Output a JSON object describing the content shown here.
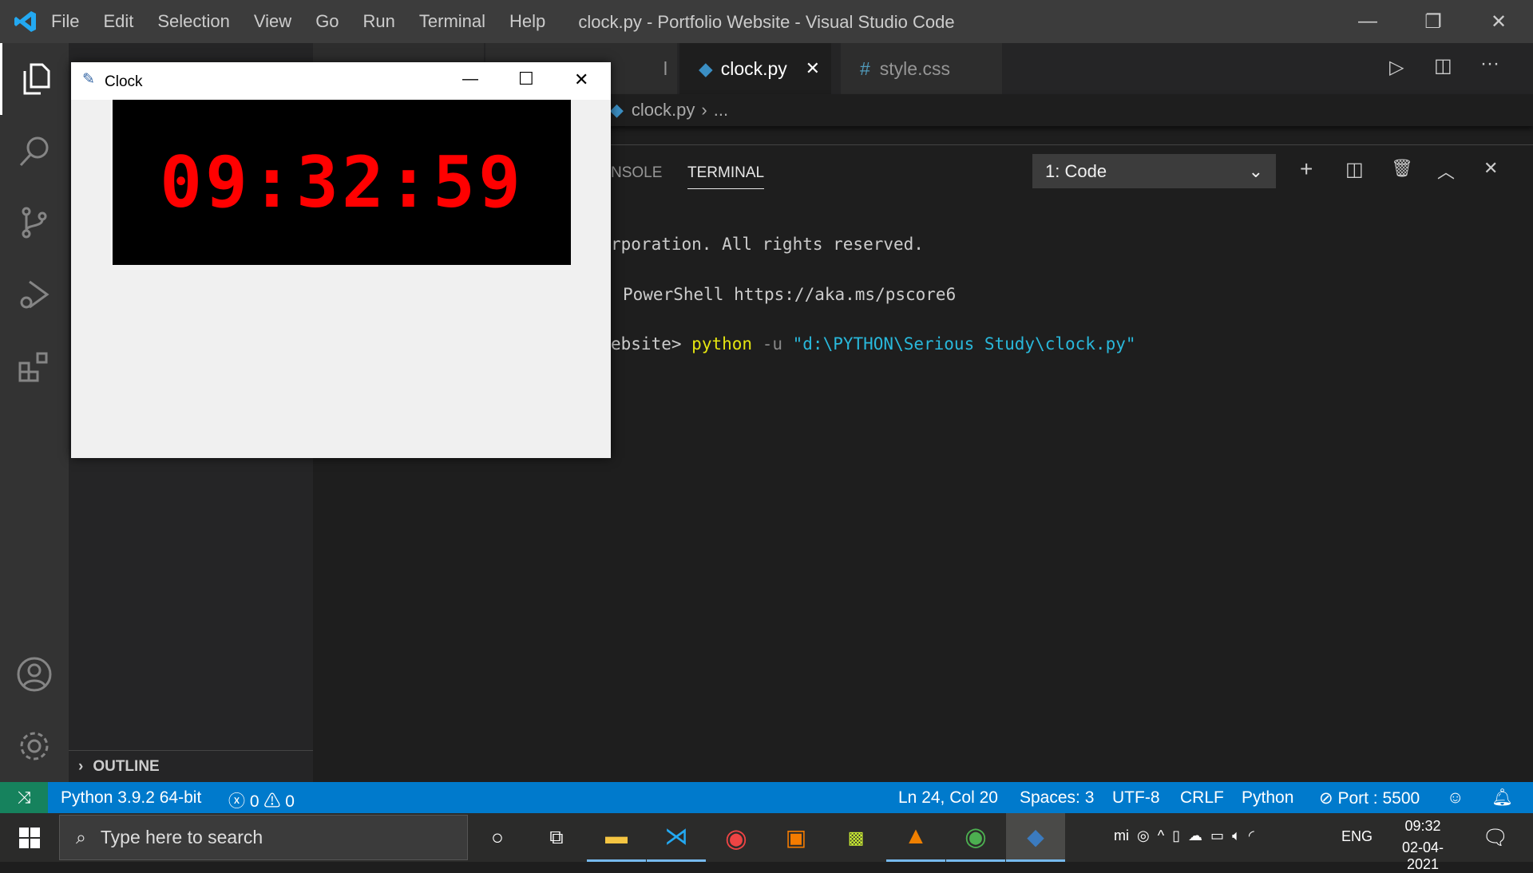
{
  "window": {
    "title": "clock.py - Portfolio Website - Visual Studio Code"
  },
  "menu": [
    "File",
    "Edit",
    "Selection",
    "View",
    "Go",
    "Run",
    "Terminal",
    "Help"
  ],
  "tabs": [
    {
      "label": "l",
      "partial": true
    },
    {
      "label": "clock.py",
      "active": true
    },
    {
      "label": "style.css",
      "icon": "#"
    }
  ],
  "breadcrumb": {
    "file": "clock.py",
    "sep": "›",
    "rest": "..."
  },
  "sidebar": {
    "outline": "OUTLINE"
  },
  "panel": {
    "tabs": [
      "NSOLE",
      "TERMINAL"
    ],
    "active": "TERMINAL",
    "terminal_select": "1: Code",
    "lines": [
      "rporation. All rights reserved.",
      "PowerShell https://aka.ms/pscore6"
    ],
    "prompt": "ebsite>",
    "cmd": "python",
    "flag": "-u",
    "arg": "\"d:\\PYTHON\\Serious Study\\clock.py\""
  },
  "status": {
    "python": "Python 3.9.2 64-bit",
    "errors": "0",
    "warnings": "0",
    "position": "Ln 24, Col 20",
    "spaces": "Spaces: 3",
    "encoding": "UTF-8",
    "eol": "CRLF",
    "language": "Python",
    "port": "Port : 5500"
  },
  "clock_window": {
    "title": "Clock",
    "time": "09:32:59",
    "color": "#ff0000"
  },
  "taskbar": {
    "search_placeholder": "Type here to search",
    "lang": "ENG",
    "time": "09:32",
    "date": "02-04-2021"
  },
  "colors": {
    "accent": "#007acc"
  }
}
